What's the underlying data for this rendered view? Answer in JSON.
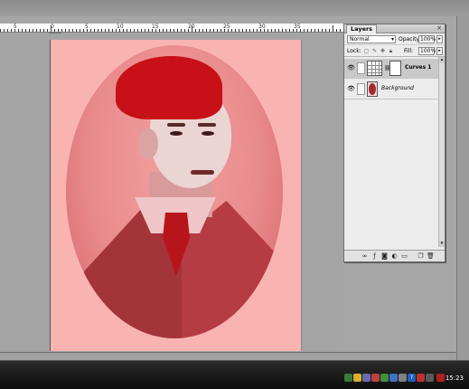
{
  "ruler": {
    "labels": [
      "5",
      "0",
      "5",
      "10",
      "15",
      "20",
      "25",
      "30",
      "35"
    ]
  },
  "layers_panel": {
    "tab_label": "Layers",
    "close_glyph": "×",
    "blend_mode": "Normal",
    "opacity_label": "Opacity:",
    "opacity_value": "100%",
    "lock_label": "Lock:",
    "fill_label": "Fill:",
    "fill_value": "100%",
    "layers": [
      {
        "name": "Curves 1",
        "type": "adjustment",
        "visible": true,
        "selected": true
      },
      {
        "name": "Background",
        "type": "image",
        "visible": true,
        "locked": true
      }
    ]
  },
  "taskbar": {
    "clock": "15:23"
  },
  "colors": {
    "canvas_bg": "#f9b4b2",
    "workspace": "#a6a6a6",
    "taskbar": "#0d0d0d"
  }
}
